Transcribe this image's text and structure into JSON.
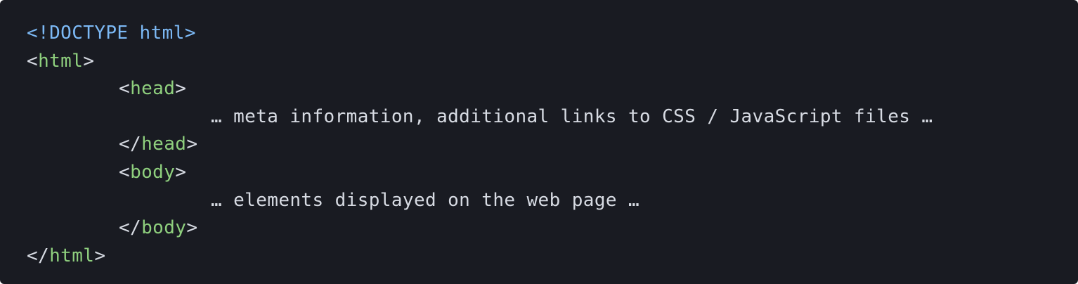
{
  "code": {
    "doctype": "<!DOCTYPE html>",
    "lines": [
      {
        "open": "<",
        "tag": "html",
        "close": ">"
      },
      {
        "open": "<",
        "tag": "head",
        "close": ">"
      },
      {
        "text": "… meta information, additional links to CSS / JavaScript files …"
      },
      {
        "open": "</",
        "tag": "head",
        "close": ">"
      },
      {
        "open": "<",
        "tag": "body",
        "close": ">"
      },
      {
        "text": "… elements displayed on the web page …"
      },
      {
        "open": "</",
        "tag": "body",
        "close": ">"
      },
      {
        "open": "</",
        "tag": "html",
        "close": ">"
      }
    ]
  },
  "colors": {
    "background": "#191b22",
    "doctype": "#7cb9f5",
    "tag_name": "#8fd07e",
    "punctuation": "#d7dbe3",
    "text": "#d7dbe3"
  }
}
